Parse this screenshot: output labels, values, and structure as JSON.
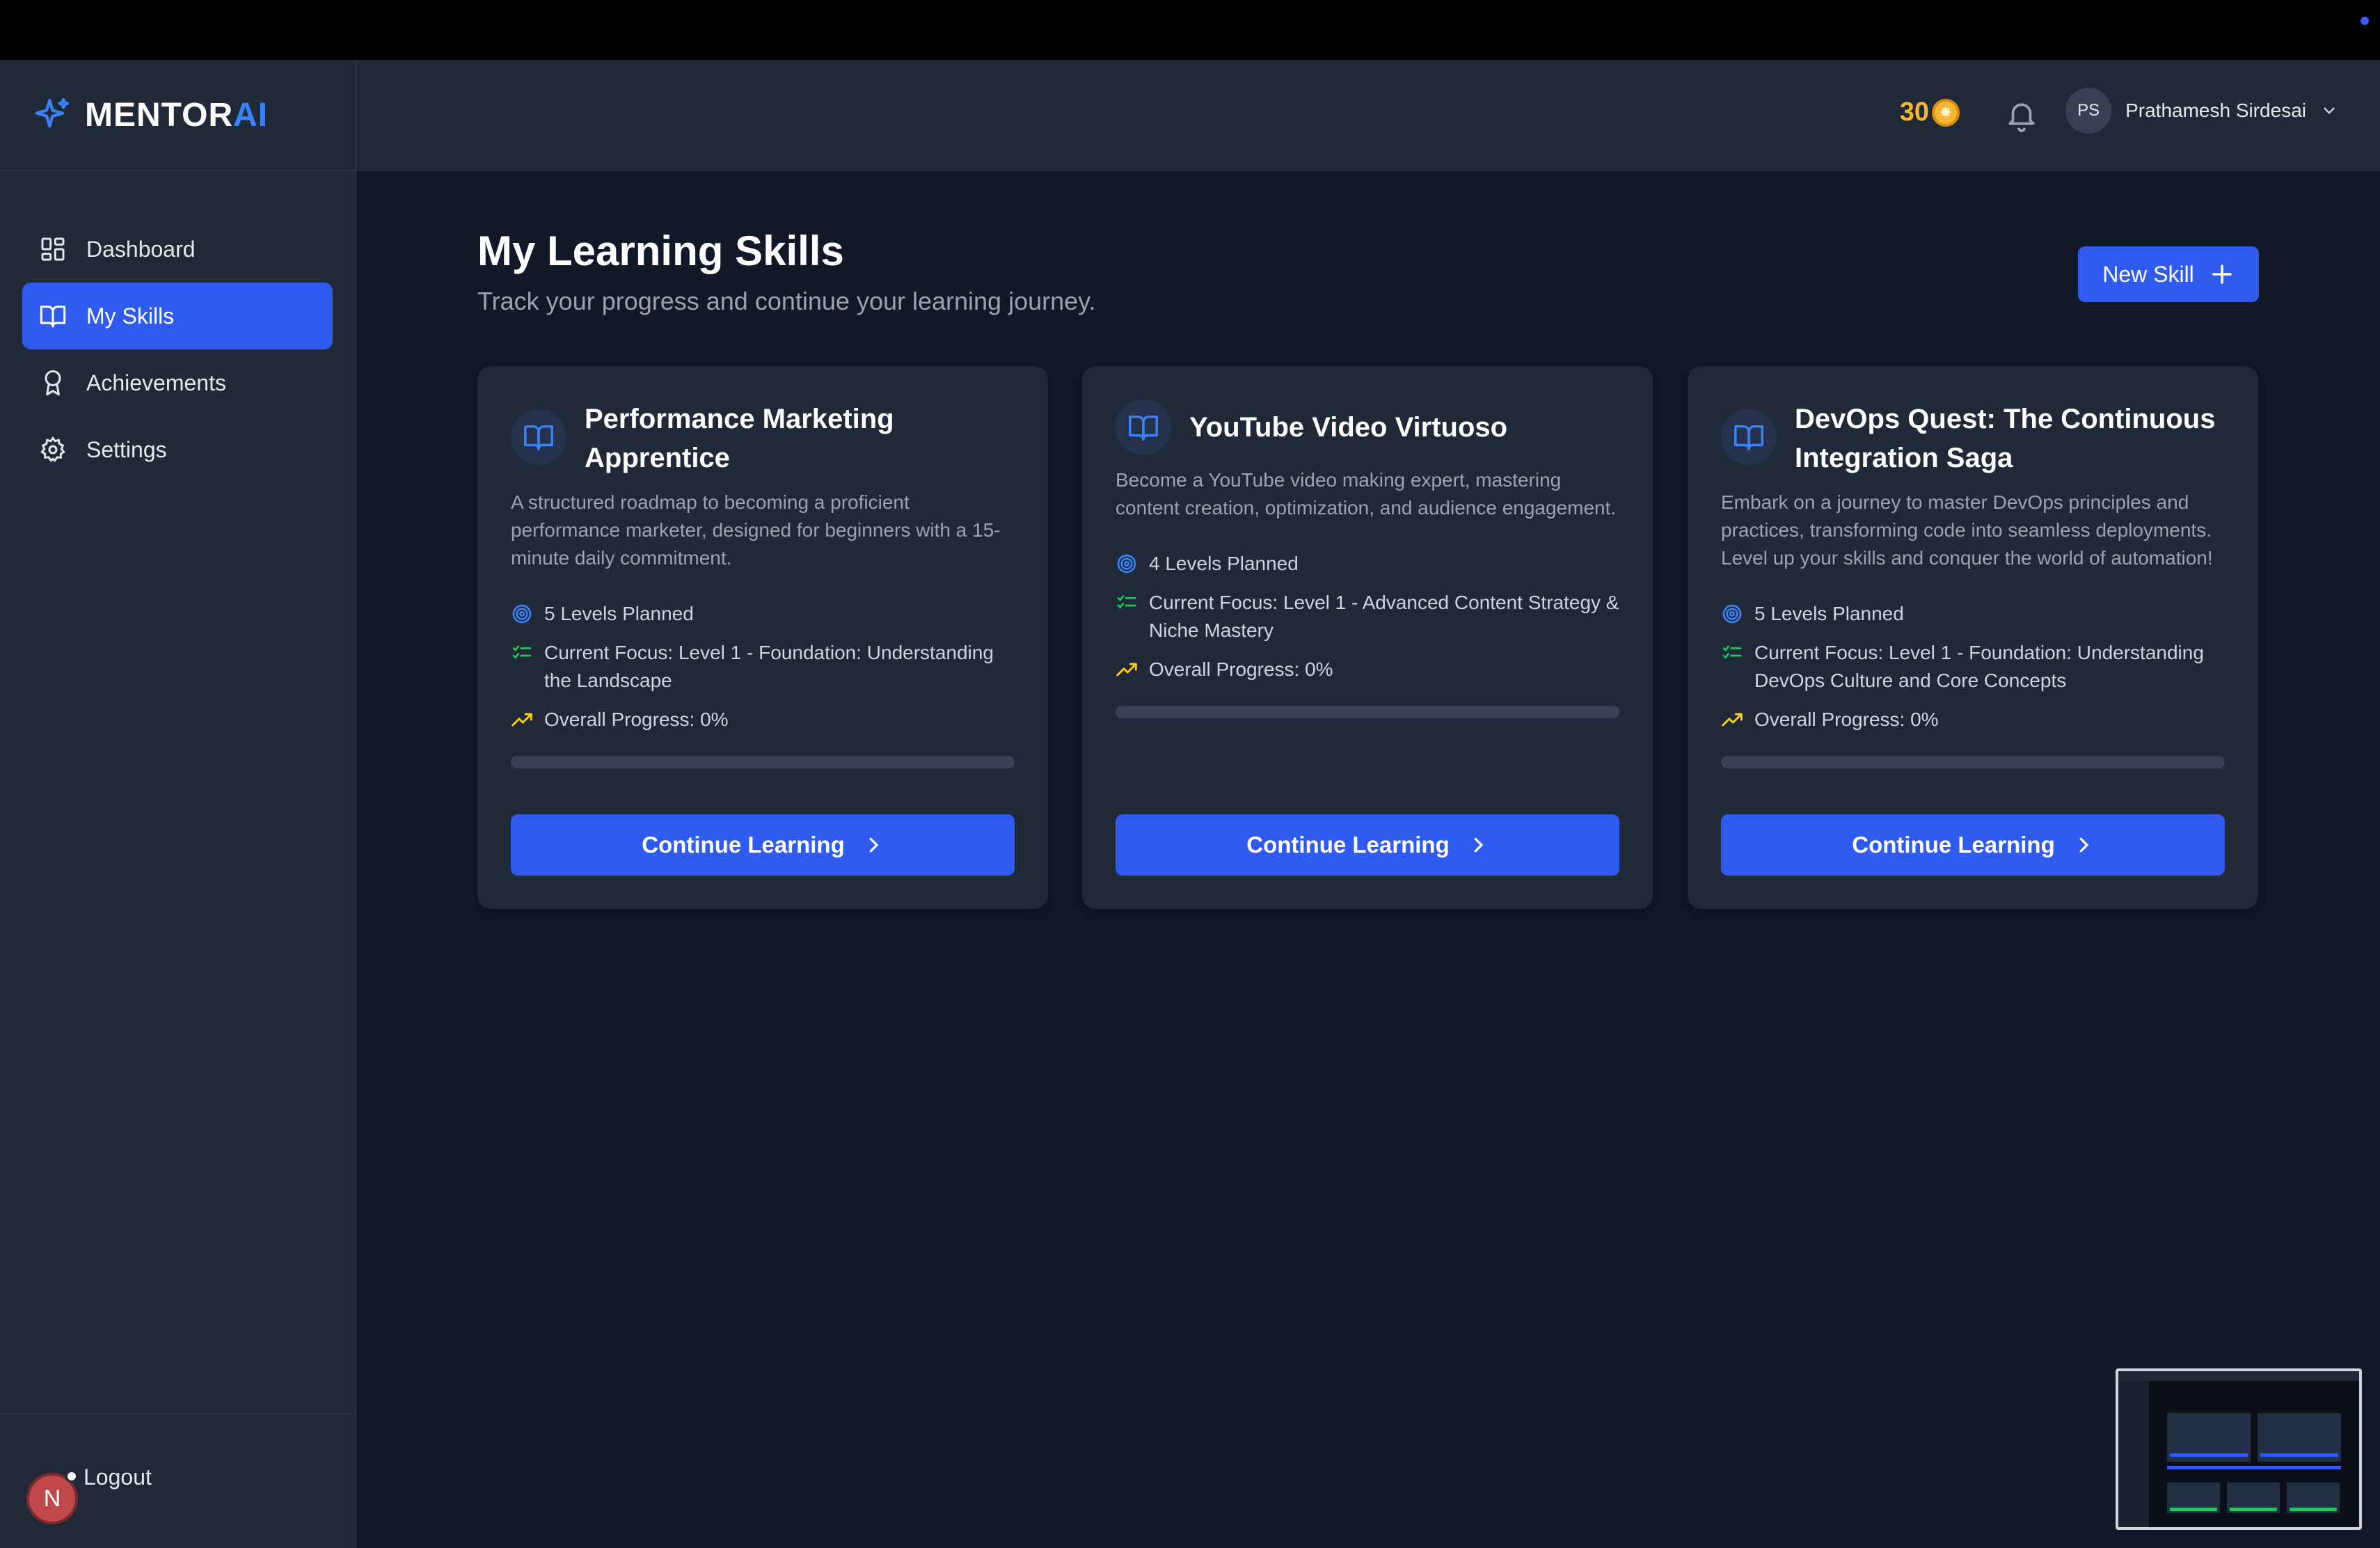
{
  "brand": {
    "name_main": "MENTOR",
    "name_accent": "AI"
  },
  "sidebar": {
    "items": [
      {
        "label": "Dashboard",
        "icon": "dashboard-grid-icon",
        "active": false
      },
      {
        "label": "My Skills",
        "icon": "book-open-icon",
        "active": true
      },
      {
        "label": "Achievements",
        "icon": "award-icon",
        "active": false
      },
      {
        "label": "Settings",
        "icon": "gear-icon",
        "active": false
      }
    ],
    "logout_label": "Logout",
    "logout_avatar_letter": "N"
  },
  "header": {
    "coins": "30",
    "user_initials": "PS",
    "user_name": "Prathamesh Sirdesai"
  },
  "page": {
    "title": "My Learning Skills",
    "subtitle": "Track your progress and continue your learning journey.",
    "new_skill_label": "New Skill"
  },
  "cards": [
    {
      "title": "Performance Marketing Apprentice",
      "description": "A structured roadmap to becoming a proficient performance marketer, designed for beginners with a 15-minute daily commitment.",
      "levels": "5 Levels Planned",
      "focus": "Current Focus: Level 1 - Foundation: Understanding the Landscape",
      "progress_label": "Overall Progress: 0%",
      "progress": 0,
      "button": "Continue Learning"
    },
    {
      "title": "YouTube Video Virtuoso",
      "description": "Become a YouTube video making expert, mastering content creation, optimization, and audience engagement.",
      "levels": "4 Levels Planned",
      "focus": "Current Focus: Level 1 - Advanced Content Strategy & Niche Mastery",
      "progress_label": "Overall Progress: 0%",
      "progress": 0,
      "button": "Continue Learning"
    },
    {
      "title": "DevOps Quest: The Continuous Integration Saga",
      "description": "Embark on a journey to master DevOps principles and practices, transforming code into seamless deployments. Level up your skills and conquer the world of automation!",
      "levels": "5 Levels Planned",
      "focus": "Current Focus: Level 1 - Foundation: Understanding DevOps Culture and Core Concepts",
      "progress_label": "Overall Progress: 0%",
      "progress": 0,
      "button": "Continue Learning"
    }
  ],
  "colors": {
    "accent": "#2f5bf0",
    "coin": "#f5b731",
    "target_icon": "#3b82f6",
    "list_icon": "#22c55e",
    "trend_icon": "#facc15"
  }
}
